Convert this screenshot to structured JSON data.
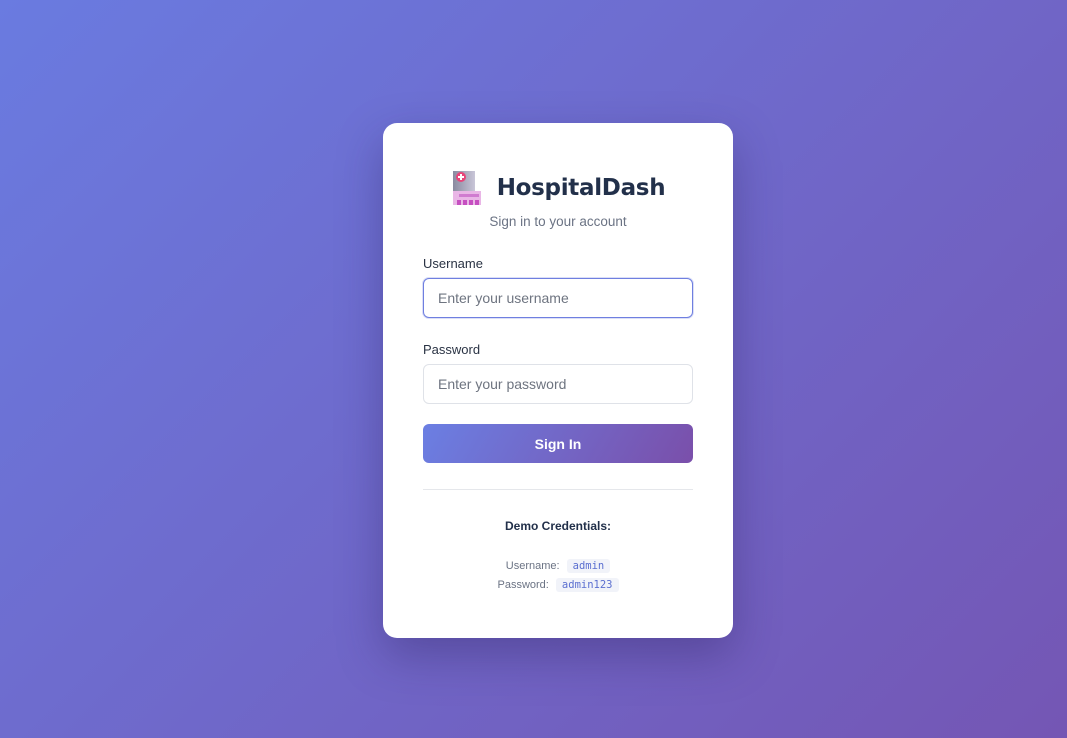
{
  "brand": {
    "title": "HospitalDash",
    "icon": "hospital-icon",
    "subtitle": "Sign in to your account"
  },
  "form": {
    "username": {
      "label": "Username",
      "placeholder": "Enter your username",
      "value": ""
    },
    "password": {
      "label": "Password",
      "placeholder": "Enter your password",
      "value": ""
    },
    "submit_label": "Sign In"
  },
  "demo": {
    "title": "Demo Credentials:",
    "username_label": "Username:",
    "username_value": "admin",
    "password_label": "Password:",
    "password_value": "admin123"
  },
  "colors": {
    "background_start": "#6a7be0",
    "background_end": "#7456b4",
    "accent": "#6f7fe0",
    "button_start": "#6b7fe3",
    "button_end": "#7a4faa"
  }
}
